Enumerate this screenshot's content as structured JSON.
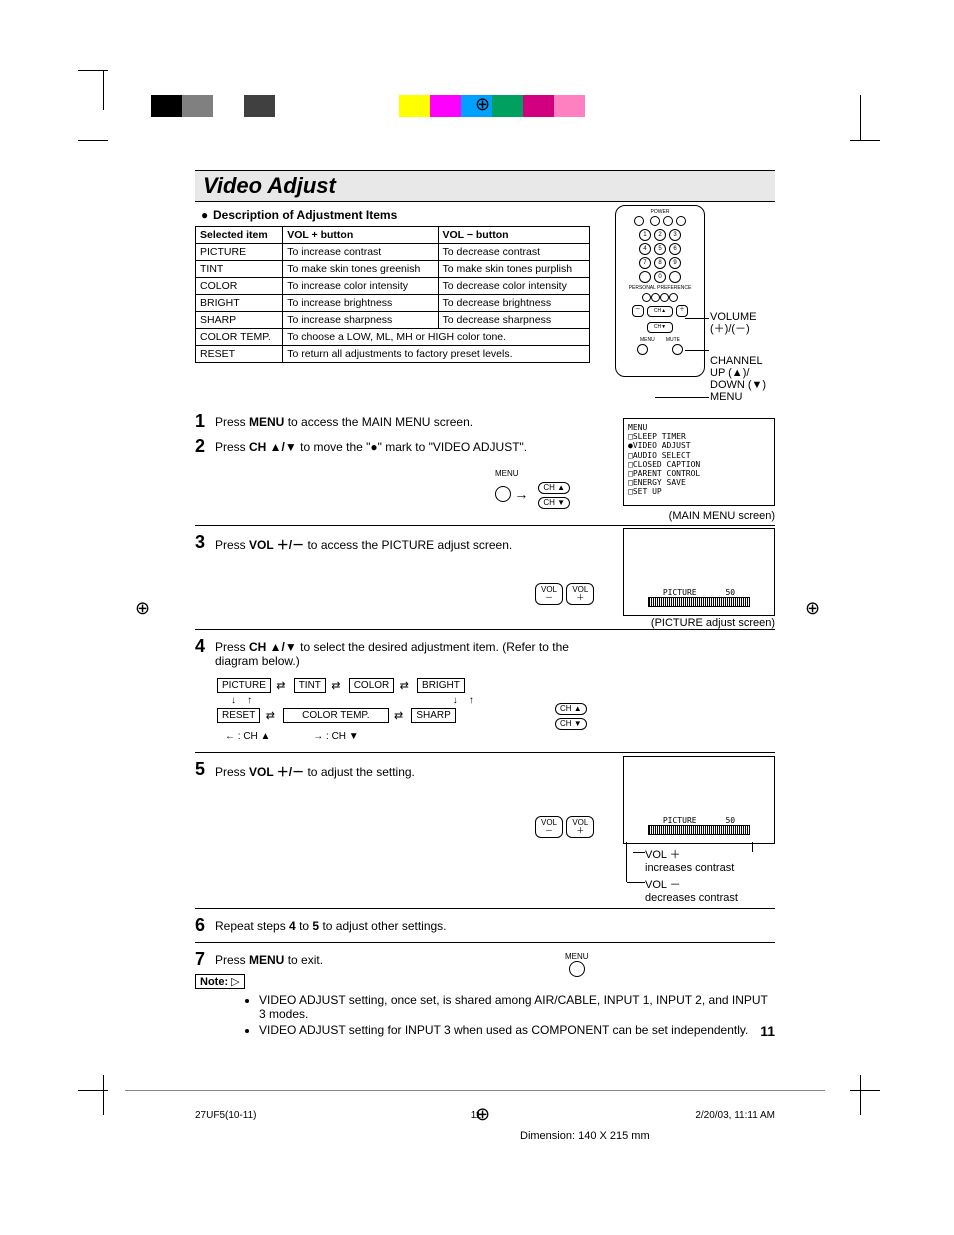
{
  "colorbar": [
    "#ffffff",
    "#000000",
    "#808080",
    "#ffffff",
    "#404040",
    "#ffffff",
    "#ffffff",
    "#ffffff",
    "#ffffff",
    "#ffff00",
    "#ff00ff",
    "#00a0ff",
    "#00a060",
    "#d00080",
    "#ff80c0",
    "#ffffff"
  ],
  "title": "Video Adjust",
  "subheading": "Description of Adjustment Items",
  "table": {
    "headers": [
      "Selected item",
      "VOL + button",
      "VOL − button"
    ],
    "rows": [
      [
        "PICTURE",
        "To increase contrast",
        "To decrease contrast"
      ],
      [
        "TINT",
        "To make skin tones greenish",
        "To make skin tones purplish"
      ],
      [
        "COLOR",
        "To increase color intensity",
        "To decrease color intensity"
      ],
      [
        "BRIGHT",
        "To increase brightness",
        "To decrease brightness"
      ],
      [
        "SHARP",
        "To increase sharpness",
        "To decrease sharpness"
      ],
      [
        "COLOR TEMP.",
        "To choose a LOW, ML, MH or HIGH color tone.",
        ""
      ],
      [
        "RESET",
        "To return all adjustments to factory preset levels.",
        ""
      ]
    ]
  },
  "remote_labels": {
    "volume": "VOLUME",
    "volume_sub": "(＋)/(－)",
    "channel": "CHANNEL",
    "channel_sub": "UP (▲)/\nDOWN (▼)",
    "menu": "MENU"
  },
  "steps": {
    "s1": {
      "n": "1",
      "pre": "Press ",
      "bold": "MENU",
      "post": " to access the MAIN MENU screen."
    },
    "s2": {
      "n": "2",
      "pre": "Press ",
      "bold": "CH ▲/▼",
      "post": " to move the \"●\" mark to \"VIDEO ADJUST\"."
    },
    "s3": {
      "n": "3",
      "pre": "Press ",
      "bold": "VOL ＋/－",
      "post": " to access the PICTURE adjust screen."
    },
    "s4": {
      "n": "4",
      "pre": "Press ",
      "bold": "CH ▲/▼",
      "post": " to select the desired adjustment item. (Refer to the diagram below.)"
    },
    "s5": {
      "n": "5",
      "pre": "Press ",
      "bold": "VOL ＋/－",
      "post": " to adjust the setting."
    },
    "s6": {
      "n": "6",
      "pre": "Repeat steps ",
      "bold": "4",
      "mid": " to ",
      "bold2": "5",
      "post": " to adjust other settings."
    },
    "s7": {
      "n": "7",
      "pre": "Press ",
      "bold": "MENU",
      "post": " to exit."
    }
  },
  "menu_screen": {
    "title": "MENU",
    "items": [
      "SLEEP TIMER",
      "VIDEO ADJUST",
      "AUDIO SELECT",
      "CLOSED CAPTION",
      "PARENT CONTROL",
      "ENERGY SAVE",
      "SET UP"
    ],
    "caption": "(MAIN MENU screen)"
  },
  "picture_screen": {
    "label": "PICTURE",
    "value": "50",
    "caption": "(PICTURE adjust screen)"
  },
  "diagram_boxes": {
    "r1": [
      "PICTURE",
      "TINT",
      "COLOR",
      "BRIGHT"
    ],
    "r2": [
      "RESET",
      "COLOR TEMP.",
      "SHARP"
    ],
    "legend_left": "← : CH ▲",
    "legend_right": "→ : CH ▼"
  },
  "adjust_screen5": {
    "label": "PICTURE",
    "value": "50",
    "plus": "VOL ＋\nincreases contrast",
    "minus": "VOL －\ndecreases contrast"
  },
  "buttons": {
    "menu": "MENU",
    "chup": "CH ▲",
    "chdn": "CH ▼",
    "volp": "VOL\n＋",
    "volm": "VOL\n－"
  },
  "note_label": "Note:",
  "notes": [
    "VIDEO ADJUST setting, once set, is shared among AIR/CABLE, INPUT 1, INPUT 2, and INPUT 3 modes.",
    "VIDEO ADJUST setting for INPUT 3 when used as COMPONENT can be set independently."
  ],
  "page_number": "11",
  "footer": {
    "left": "27UF5(10-11)",
    "center": "11",
    "right": "2/20/03, 11:11 AM"
  },
  "dimension": "Dimension: 140  X 215 mm"
}
